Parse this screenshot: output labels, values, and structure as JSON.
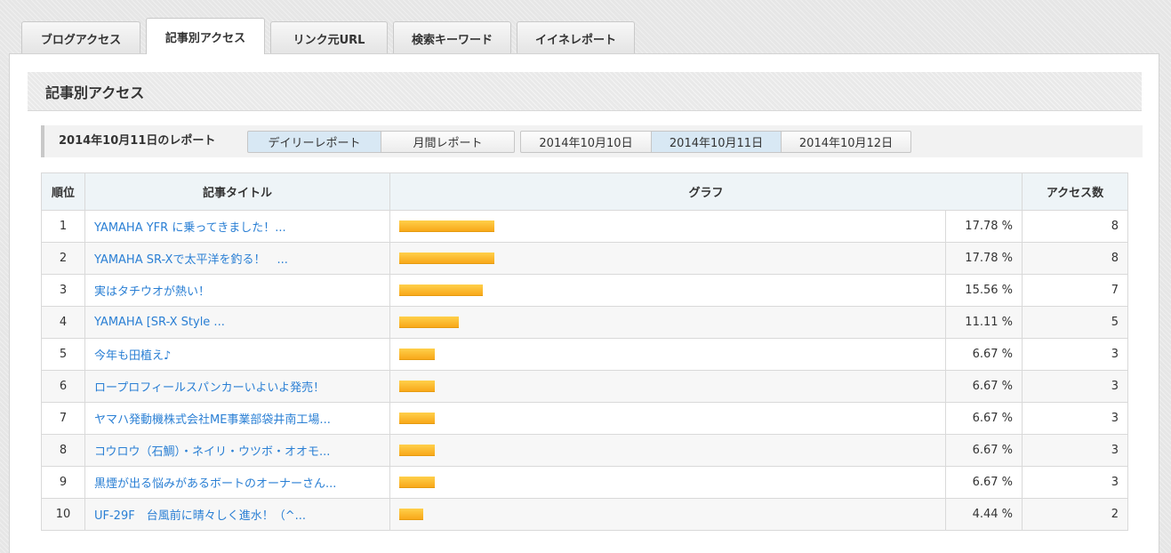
{
  "tabs": [
    {
      "label": "ブログアクセス",
      "active": false
    },
    {
      "label": "記事別アクセス",
      "active": true
    },
    {
      "label": "リンク元URL",
      "active": false
    },
    {
      "label": "検索キーワード",
      "active": false
    },
    {
      "label": "イイネレポート",
      "active": false
    }
  ],
  "section": {
    "title": "記事別アクセス"
  },
  "report": {
    "label": "2014年10月11日のレポート",
    "period_buttons": [
      {
        "label": "デイリーレポート",
        "selected": true
      },
      {
        "label": "月間レポート",
        "selected": false
      }
    ],
    "date_buttons": [
      {
        "label": "2014年10月10日",
        "selected": false
      },
      {
        "label": "2014年10月11日",
        "selected": true
      },
      {
        "label": "2014年10月12日",
        "selected": false
      }
    ]
  },
  "table": {
    "headers": {
      "rank": "順位",
      "title": "記事タイトル",
      "graph": "グラフ",
      "count": "アクセス数"
    },
    "rows": [
      {
        "rank": "1",
        "title": "YAMAHA YFR に乗ってきました！...",
        "percent": "17.78 %",
        "share": 17.78,
        "count": "8"
      },
      {
        "rank": "2",
        "title": "YAMAHA SR-Xで太平洋を釣る！　...",
        "percent": "17.78 %",
        "share": 17.78,
        "count": "8"
      },
      {
        "rank": "3",
        "title": "実はタチウオが熱い！",
        "percent": "15.56 %",
        "share": 15.56,
        "count": "7"
      },
      {
        "rank": "4",
        "title": "YAMAHA [SR-X Style ...",
        "percent": "11.11 %",
        "share": 11.11,
        "count": "5"
      },
      {
        "rank": "5",
        "title": "今年も田植え♪",
        "percent": "6.67 %",
        "share": 6.67,
        "count": "3"
      },
      {
        "rank": "6",
        "title": "ロープロフィールスパンカーいよいよ発売！",
        "percent": "6.67 %",
        "share": 6.67,
        "count": "3"
      },
      {
        "rank": "7",
        "title": "ヤマハ発動機株式会社ME事業部袋井南工場...",
        "percent": "6.67 %",
        "share": 6.67,
        "count": "3"
      },
      {
        "rank": "8",
        "title": "コウロウ（石鯛）・ネイリ・ウツボ・オオモ...",
        "percent": "6.67 %",
        "share": 6.67,
        "count": "3"
      },
      {
        "rank": "9",
        "title": "黒煙が出る悩みがあるボートのオーナーさん...",
        "percent": "6.67 %",
        "share": 6.67,
        "count": "3"
      },
      {
        "rank": "10",
        "title": "UF-29F　台風前に晴々しく進水！（^...",
        "percent": "4.44 %",
        "share": 4.44,
        "count": "2"
      }
    ]
  },
  "colors": {
    "link": "#2a7fd4",
    "bar": "#f8a81a",
    "selected_button": "#d8e8f4",
    "header_bg": "#eef4f7"
  }
}
